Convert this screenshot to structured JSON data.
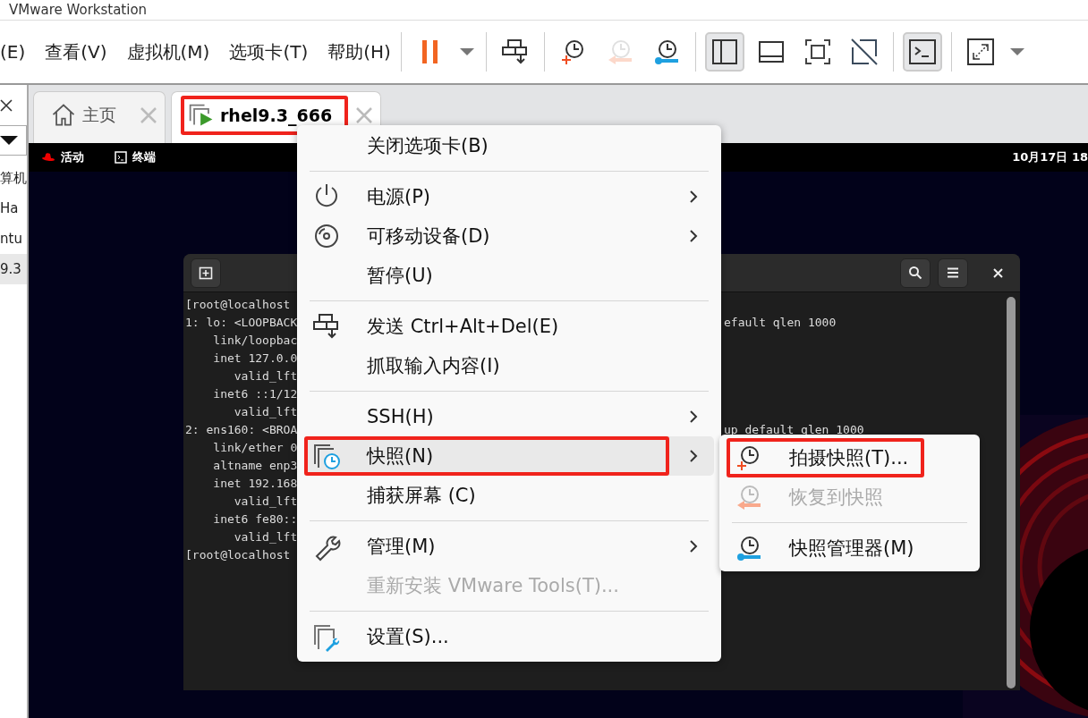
{
  "window": {
    "title": "VMware Workstation"
  },
  "menu_bar": [
    "(E)",
    "查看(V)",
    "虚拟机(M)",
    "选项卡(T)",
    "帮助(H)"
  ],
  "toolbar": [
    [
      {
        "kind": "pause",
        "selected": false,
        "disabled": false
      },
      {
        "kind": "dropdown",
        "selected": false,
        "disabled": false
      }
    ],
    [
      {
        "kind": "send-keys",
        "selected": false,
        "disabled": false
      }
    ],
    [
      {
        "kind": "snapshot-take",
        "selected": false,
        "disabled": false
      },
      {
        "kind": "snapshot-revert",
        "selected": false,
        "disabled": true
      },
      {
        "kind": "snapshot-manager",
        "selected": false,
        "disabled": false
      }
    ],
    [
      {
        "kind": "library",
        "selected": true,
        "disabled": false
      },
      {
        "kind": "thumbnail",
        "selected": false,
        "disabled": false
      },
      {
        "kind": "fullscreen",
        "selected": false,
        "disabled": false
      },
      {
        "kind": "unity",
        "selected": false,
        "disabled": false
      }
    ],
    [
      {
        "kind": "console",
        "selected": true,
        "disabled": false
      }
    ],
    [
      {
        "kind": "stretch",
        "selected": false,
        "disabled": false
      },
      {
        "kind": "dropdown",
        "selected": false,
        "disabled": false
      }
    ]
  ],
  "sidebar": {
    "items": [
      {
        "label": "算机",
        "selected": false
      },
      {
        "label": "Ha",
        "selected": false
      },
      {
        "label": "ntu",
        "selected": false
      },
      {
        "label": "9.3",
        "selected": true
      }
    ]
  },
  "tabs": [
    {
      "kind": "home",
      "label": "主页",
      "selected": false,
      "annotated": false
    },
    {
      "kind": "vm",
      "label": "rhel9.3_666",
      "selected": true,
      "annotated": true
    }
  ],
  "guest": {
    "top_bar": {
      "activities": "活动",
      "app": "终端",
      "clock": "10月17日 18"
    },
    "terminal": {
      "lines": [
        {
          "left": "[root@localhost"
        },
        {
          "left": "1: lo: <LOOPBACK",
          "right": "efault qlen 1000"
        },
        {
          "left": "    link/loopbac"
        },
        {
          "left": "    inet 127.0.0"
        },
        {
          "left": "       valid_lft"
        },
        {
          "left": "    inet6 ::1/12"
        },
        {
          "left": "       valid_lft"
        },
        {
          "left": "2: ens160: <BROA",
          "right": "up default qlen 1000"
        },
        {
          "left": "    link/ether 0"
        },
        {
          "left": "    altname enp3"
        },
        {
          "left": "    inet 192.168"
        },
        {
          "left": "       valid_lft"
        },
        {
          "left": "    inet6 fe80::"
        },
        {
          "left": "       valid_lft"
        },
        {
          "left": "[root@localhost"
        }
      ]
    }
  },
  "context_menu": {
    "items": [
      {
        "kind": "plain",
        "label": "关闭选项卡(B)",
        "submenu": false,
        "disabled": false,
        "selected": false,
        "annotated": false
      },
      {
        "kind": "separator"
      },
      {
        "kind": "power",
        "label": "电源(P)",
        "submenu": true,
        "disabled": false,
        "selected": false,
        "annotated": false
      },
      {
        "kind": "disc",
        "label": "可移动设备(D)",
        "submenu": true,
        "disabled": false,
        "selected": false,
        "annotated": false
      },
      {
        "kind": "plain",
        "label": "暂停(U)",
        "submenu": false,
        "disabled": false,
        "selected": false,
        "annotated": false
      },
      {
        "kind": "separator"
      },
      {
        "kind": "send-keys",
        "label": "发送 Ctrl+Alt+Del(E)",
        "submenu": false,
        "disabled": false,
        "selected": false,
        "annotated": false
      },
      {
        "kind": "plain",
        "label": "抓取输入内容(I)",
        "submenu": false,
        "disabled": false,
        "selected": false,
        "annotated": false
      },
      {
        "kind": "separator"
      },
      {
        "kind": "plain",
        "label": "SSH(H)",
        "submenu": true,
        "disabled": false,
        "selected": false,
        "annotated": false
      },
      {
        "kind": "snapshot",
        "label": "快照(N)",
        "submenu": true,
        "disabled": false,
        "selected": true,
        "annotated": true
      },
      {
        "kind": "plain",
        "label": "捕获屏幕 (C)",
        "submenu": false,
        "disabled": false,
        "selected": false,
        "annotated": false
      },
      {
        "kind": "separator"
      },
      {
        "kind": "wrench",
        "label": "管理(M)",
        "submenu": true,
        "disabled": false,
        "selected": false,
        "annotated": false
      },
      {
        "kind": "plain",
        "label": "重新安装 VMware Tools(T)...",
        "submenu": false,
        "disabled": true,
        "selected": false,
        "annotated": false
      },
      {
        "kind": "separator"
      },
      {
        "kind": "settings",
        "label": "设置(S)...",
        "submenu": false,
        "disabled": false,
        "selected": false,
        "annotated": false
      }
    ]
  },
  "snapshot_submenu": {
    "items": [
      {
        "kind": "snapshot-take",
        "label": "拍摄快照(T)...",
        "disabled": false,
        "annotated": true
      },
      {
        "kind": "snapshot-revert",
        "label": "恢复到快照",
        "disabled": true,
        "annotated": false
      },
      {
        "kind": "separator"
      },
      {
        "kind": "snapshot-manager",
        "label": "快照管理器(M)",
        "disabled": false,
        "annotated": false
      }
    ]
  }
}
